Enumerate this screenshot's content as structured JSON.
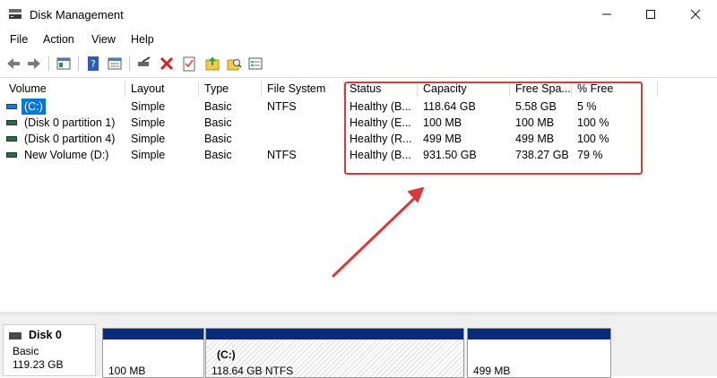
{
  "window": {
    "title": "Disk Management"
  },
  "menu": {
    "items": [
      "File",
      "Action",
      "View",
      "Help"
    ]
  },
  "list": {
    "columns": [
      "Volume",
      "Layout",
      "Type",
      "File System",
      "Status",
      "Capacity",
      "Free Spa...",
      "% Free"
    ],
    "rows": [
      {
        "volume": "(C:)",
        "layout": "Simple",
        "type": "Basic",
        "fs": "NTFS",
        "status": "Healthy (B...",
        "capacity": "118.64 GB",
        "free": "5.58 GB",
        "pct": "5 %"
      },
      {
        "volume": "(Disk 0 partition 1)",
        "layout": "Simple",
        "type": "Basic",
        "fs": "",
        "status": "Healthy (E...",
        "capacity": "100 MB",
        "free": "100 MB",
        "pct": "100 %"
      },
      {
        "volume": "(Disk 0 partition 4)",
        "layout": "Simple",
        "type": "Basic",
        "fs": "",
        "status": "Healthy (R...",
        "capacity": "499 MB",
        "free": "499 MB",
        "pct": "100 %"
      },
      {
        "volume": "New Volume (D:)",
        "layout": "Simple",
        "type": "Basic",
        "fs": "NTFS",
        "status": "Healthy (B...",
        "capacity": "931.50 GB",
        "free": "738.27 GB",
        "pct": "79 %"
      }
    ]
  },
  "disk": {
    "name": "Disk 0",
    "type": "Basic",
    "size": "119.23 GB",
    "partitions": [
      {
        "title": "",
        "size": "100 MB"
      },
      {
        "title": "(C:)",
        "size": "118.64 GB NTFS"
      },
      {
        "title": "",
        "size": "499 MB"
      }
    ]
  },
  "colors": {
    "highlight": "#d63b3b",
    "selection": "#0078d7",
    "partition_bar": "#0a2a7a"
  }
}
